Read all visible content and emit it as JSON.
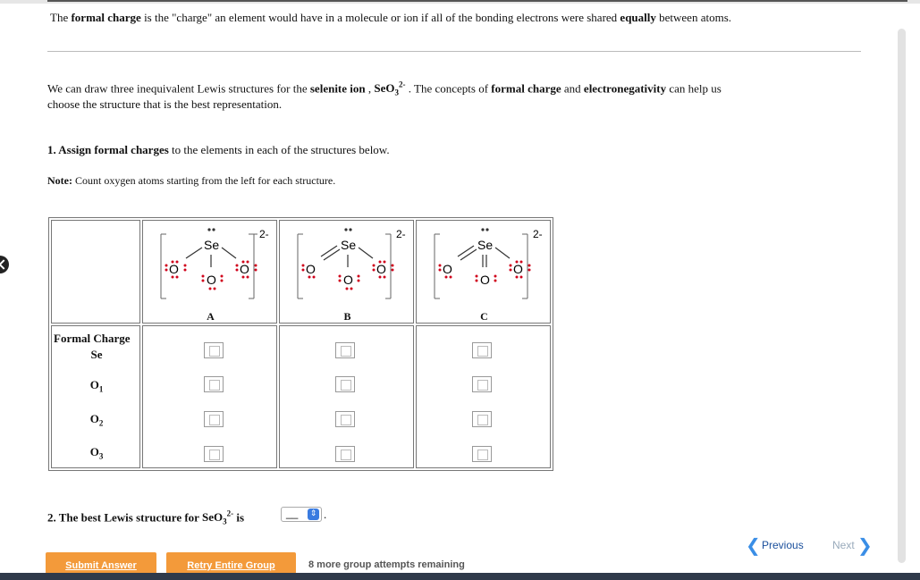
{
  "intro": {
    "line1_pre": "The ",
    "line1_b1": "formal charge",
    "line1_mid": " is the \"charge\" an element would have in a molecule or ion if all of the bonding electrons were shared ",
    "line1_b2": "equally",
    "line1_post": " between atoms."
  },
  "para2": {
    "pre": "We can draw three inequivalent Lewis structures for the ",
    "b_selenite": "selenite ion",
    "comma": " , ",
    "formula_base": "SeO",
    "formula_sub": "3",
    "formula_sup": "2-",
    "mid": " . The concepts of ",
    "b_fc": "formal charge",
    "and": " and ",
    "b_en": "electronegativity",
    "post": " can help us",
    "line2": "choose the structure that is the best representation."
  },
  "q1": {
    "num": "1. ",
    "b": "Assign formal charges",
    "rest": " to the elements in each of the structures below."
  },
  "note": {
    "label": "Note:",
    "text": " Count oxygen atoms starting from the left for each structure."
  },
  "table": {
    "row_header": "Formal Charge",
    "rows": [
      "Se",
      "O",
      "O",
      "O"
    ],
    "row_subs": [
      "",
      "1",
      "2",
      "3"
    ],
    "structures": [
      {
        "label": "A",
        "charge": "2-",
        "se": "Se",
        "o": "O"
      },
      {
        "label": "B",
        "charge": "2-",
        "se": "Se",
        "o": "O"
      },
      {
        "label": "C",
        "charge": "2-",
        "se": "Se",
        "o": "O"
      }
    ]
  },
  "q2": {
    "pre": "2. The best Lewis structure for ",
    "formula_base": "SeO",
    "formula_sub": "3",
    "formula_sup": "2-",
    "is": " is",
    "select_value": "__",
    "period": "."
  },
  "buttons": {
    "submit": "Submit Answer",
    "retry": "Retry Entire Group",
    "attempts": "8 more group attempts remaining",
    "previous": "Previous",
    "next": "Next"
  },
  "colors": {
    "button": "#f39a3a",
    "lone_pair": "#d0021b",
    "link": "#1a4f9c"
  }
}
